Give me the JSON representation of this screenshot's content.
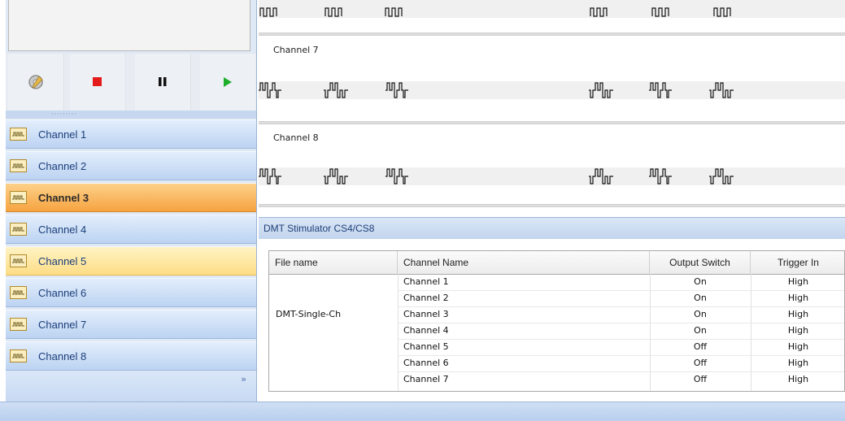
{
  "sidebar": {
    "toolbar": {
      "settings_icon": "gear-icon",
      "stop_icon": "stop-icon",
      "pause_icon": "pause-icon",
      "play_icon": "play-icon",
      "stop_color": "#e41b1b",
      "play_color": "#1fae2b"
    },
    "grip": "·········",
    "channels": [
      {
        "label": "Channel 1",
        "state": "normal"
      },
      {
        "label": "Channel 2",
        "state": "normal"
      },
      {
        "label": "Channel 3",
        "state": "active"
      },
      {
        "label": "Channel 4",
        "state": "normal"
      },
      {
        "label": "Channel 5",
        "state": "hover"
      },
      {
        "label": "Channel 6",
        "state": "normal"
      },
      {
        "label": "Channel 7",
        "state": "normal"
      },
      {
        "label": "Channel 8",
        "state": "normal"
      }
    ],
    "more_glyph": "»"
  },
  "waveforms": {
    "channel7_title": "Channel 7",
    "channel8_title": "Channel 8"
  },
  "panel": {
    "title": "DMT Stimulator CS4/CS8",
    "columns": [
      "File name",
      "Channel Name",
      "Output Switch",
      "Trigger In"
    ],
    "file_name": "DMT-Single-Ch",
    "rows": [
      {
        "channel": "Channel 1",
        "output": "On",
        "trigger": "High"
      },
      {
        "channel": "Channel 2",
        "output": "On",
        "trigger": "High"
      },
      {
        "channel": "Channel 3",
        "output": "On",
        "trigger": "High"
      },
      {
        "channel": "Channel 4",
        "output": "On",
        "trigger": "High"
      },
      {
        "channel": "Channel 5",
        "output": "Off",
        "trigger": "High"
      },
      {
        "channel": "Channel 6",
        "output": "Off",
        "trigger": "High"
      },
      {
        "channel": "Channel 7",
        "output": "Off",
        "trigger": "High"
      }
    ]
  }
}
